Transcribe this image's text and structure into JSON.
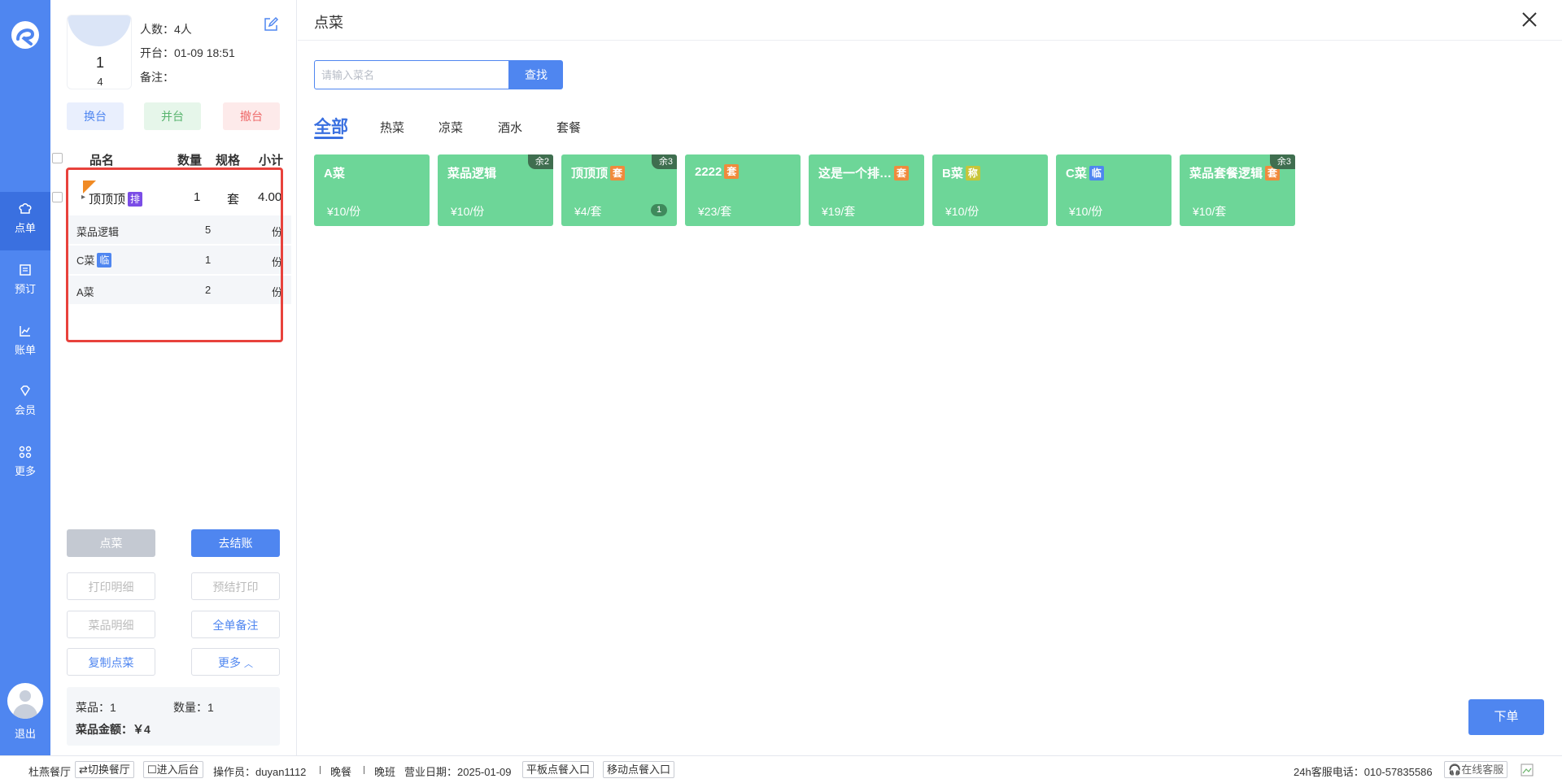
{
  "nav": {
    "items": [
      {
        "label": "点单",
        "icon": "chef-hat-icon"
      },
      {
        "label": "预订",
        "icon": "calendar-icon"
      },
      {
        "label": "账单",
        "icon": "chart-icon"
      },
      {
        "label": "会员",
        "icon": "diamond-icon"
      },
      {
        "label": "更多",
        "icon": "grid-icon"
      }
    ],
    "logout": "退出"
  },
  "table": {
    "number": "1",
    "capacity": "4",
    "people": "人数：4人",
    "open_time": "开台：01-09 18:51",
    "remark": "备注：",
    "buttons": {
      "change": "换台",
      "merge": "并台",
      "cancel": "撤台"
    }
  },
  "order_list": {
    "headers": {
      "name": "品名",
      "qty": "数量",
      "spec": "规格",
      "subtotal": "小计"
    },
    "main_item": {
      "name": "顶顶顶",
      "tag": "排",
      "qty": "1",
      "spec": "套",
      "subtotal": "4.00"
    },
    "sub_items": [
      {
        "name": "菜品逻辑",
        "tag": "",
        "qty": "5",
        "spec": "份"
      },
      {
        "name": "C菜",
        "tag": "临",
        "qty": "1",
        "spec": "份"
      },
      {
        "name": "A菜",
        "tag": "",
        "qty": "2",
        "spec": "份"
      }
    ]
  },
  "actions": {
    "order": "点菜",
    "checkout": "去结账",
    "print_detail": "打印明细",
    "pre_print": "预结打印",
    "dish_detail": "菜品明细",
    "whole_remark": "全单备注",
    "copy_order": "复制点菜",
    "more": "更多"
  },
  "summary": {
    "dishes": "菜品：1",
    "quantity": "数量：1",
    "amount": "菜品金额：￥4"
  },
  "main": {
    "title": "点菜",
    "search_placeholder": "请输入菜名",
    "search_button": "查找",
    "categories": [
      "全部",
      "热菜",
      "凉菜",
      "酒水",
      "套餐"
    ],
    "active_category": "全部",
    "dishes": [
      {
        "name": "A菜",
        "tag": "",
        "price": "¥10/份",
        "remain": "",
        "qty": ""
      },
      {
        "name": "菜品逻辑",
        "tag": "",
        "price": "¥10/份",
        "remain": "余2",
        "qty": ""
      },
      {
        "name": "顶顶顶",
        "tag": "套",
        "price": "¥4/套",
        "remain": "余3",
        "qty": "1"
      },
      {
        "name": "2222",
        "tag": "套",
        "price": "¥23/套",
        "remain": "",
        "qty": ""
      },
      {
        "name": "这是一个排…",
        "tag": "套",
        "price": "¥19/套",
        "remain": "",
        "qty": ""
      },
      {
        "name": "B菜",
        "tag": "称",
        "price": "¥10/份",
        "remain": "",
        "qty": ""
      },
      {
        "name": "C菜",
        "tag": "临",
        "price": "¥10/份",
        "remain": "",
        "qty": ""
      },
      {
        "name": "菜品套餐逻辑",
        "tag": "套",
        "price": "¥10/套",
        "remain": "余3",
        "qty": ""
      }
    ],
    "submit": "下单"
  },
  "footer": {
    "restaurant": "杜燕餐厅",
    "switch": "切换餐厅",
    "backend": "进入后台",
    "operator": "操作员：duyan1112",
    "meal": "晚餐",
    "shift": "晚班",
    "business_date": "营业日期：2025-01-09",
    "tablet_entry": "平板点餐入口",
    "mobile_entry": "移动点餐入口",
    "hotline": "24h客服电话：010-57835586",
    "online_service": "在线客服"
  },
  "colors": {
    "primary": "#4f86f0",
    "dish_card": "#6dd698",
    "highlight_border": "#e8423c"
  }
}
